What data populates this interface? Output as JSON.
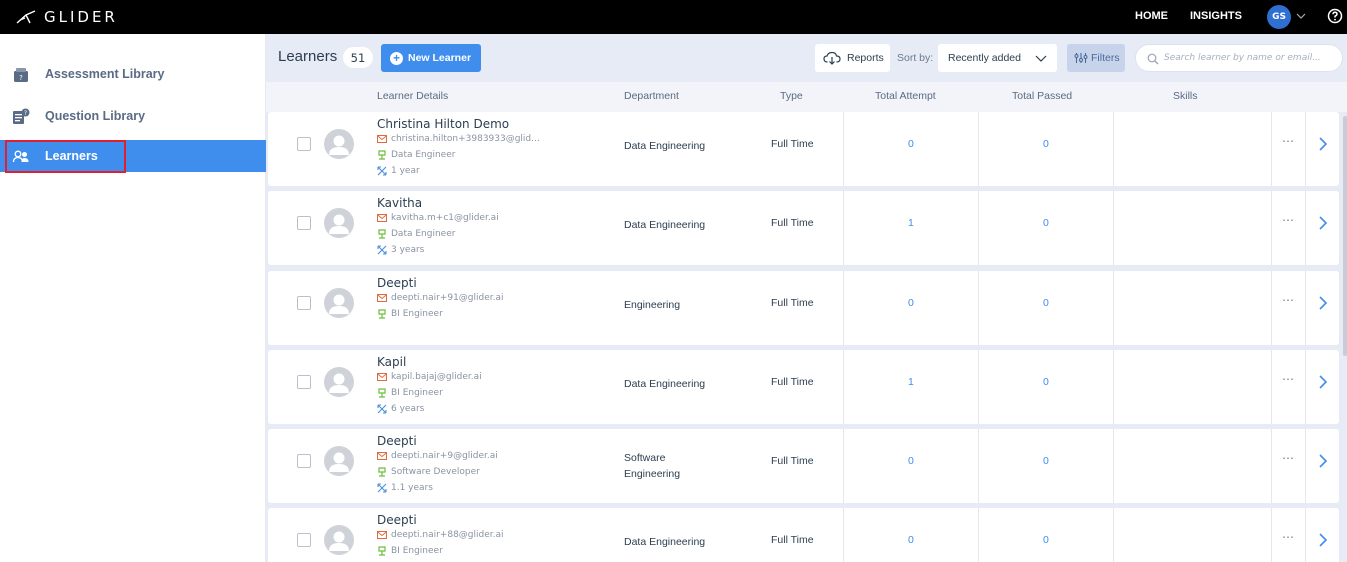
{
  "topbar": {
    "logo_text": "GLIDER",
    "nav": [
      "HOME",
      "INSIGHTS"
    ],
    "avatar_initials": "GS"
  },
  "sidebar": {
    "items": [
      {
        "label": "Assessment Library",
        "icon": "clipboard-icon"
      },
      {
        "label": "Question Library",
        "icon": "question-doc-icon"
      },
      {
        "label": "Learners",
        "icon": "users-icon",
        "active": true
      }
    ]
  },
  "header": {
    "title": "Learners",
    "count": "51",
    "new_button": "New Learner",
    "reports_button": "Reports",
    "sort_label": "Sort by:",
    "sort_value": "Recently added",
    "filters_button": "Filters",
    "search_placeholder": "Search learner by name or email..."
  },
  "columns": [
    "Learner Details",
    "Department",
    "Type",
    "Total Attempt",
    "Total Passed",
    "Skills"
  ],
  "learners": [
    {
      "name": "Christina Hilton Demo",
      "email": "christina.hilton+3983933@glid...",
      "role": "Data Engineer",
      "experience": "1 year",
      "department": [
        "Data Engineering"
      ],
      "type": "Full Time",
      "attempts": "0",
      "passed": "0"
    },
    {
      "name": "Kavitha",
      "email": "kavitha.m+c1@glider.ai",
      "role": "Data Engineer",
      "experience": "3 years",
      "department": [
        "Data Engineering"
      ],
      "type": "Full Time",
      "attempts": "1",
      "passed": "0"
    },
    {
      "name": "Deepti",
      "email": "deepti.nair+91@glider.ai",
      "role": "BI Engineer",
      "experience": "",
      "department": [
        "Engineering"
      ],
      "type": "Full Time",
      "attempts": "0",
      "passed": "0"
    },
    {
      "name": "Kapil",
      "email": "kapil.bajaj@glider.ai",
      "role": "BI Engineer",
      "experience": "6 years",
      "department": [
        "Data Engineering"
      ],
      "type": "Full Time",
      "attempts": "1",
      "passed": "0"
    },
    {
      "name": "Deepti",
      "email": "deepti.nair+9@glider.ai",
      "role": "Software Developer",
      "experience": "1.1 years",
      "department": [
        "Software",
        "Engineering"
      ],
      "type": "Full Time",
      "attempts": "0",
      "passed": "0"
    },
    {
      "name": "Deepti",
      "email": "deepti.nair+88@glider.ai",
      "role": "BI Engineer",
      "experience": "",
      "department": [
        "Data Engineering"
      ],
      "type": "Full Time",
      "attempts": "0",
      "passed": "0"
    }
  ],
  "colors": {
    "accent": "#3f8ded",
    "highlight_outline": "#e0202e",
    "topbar": "#000000"
  }
}
